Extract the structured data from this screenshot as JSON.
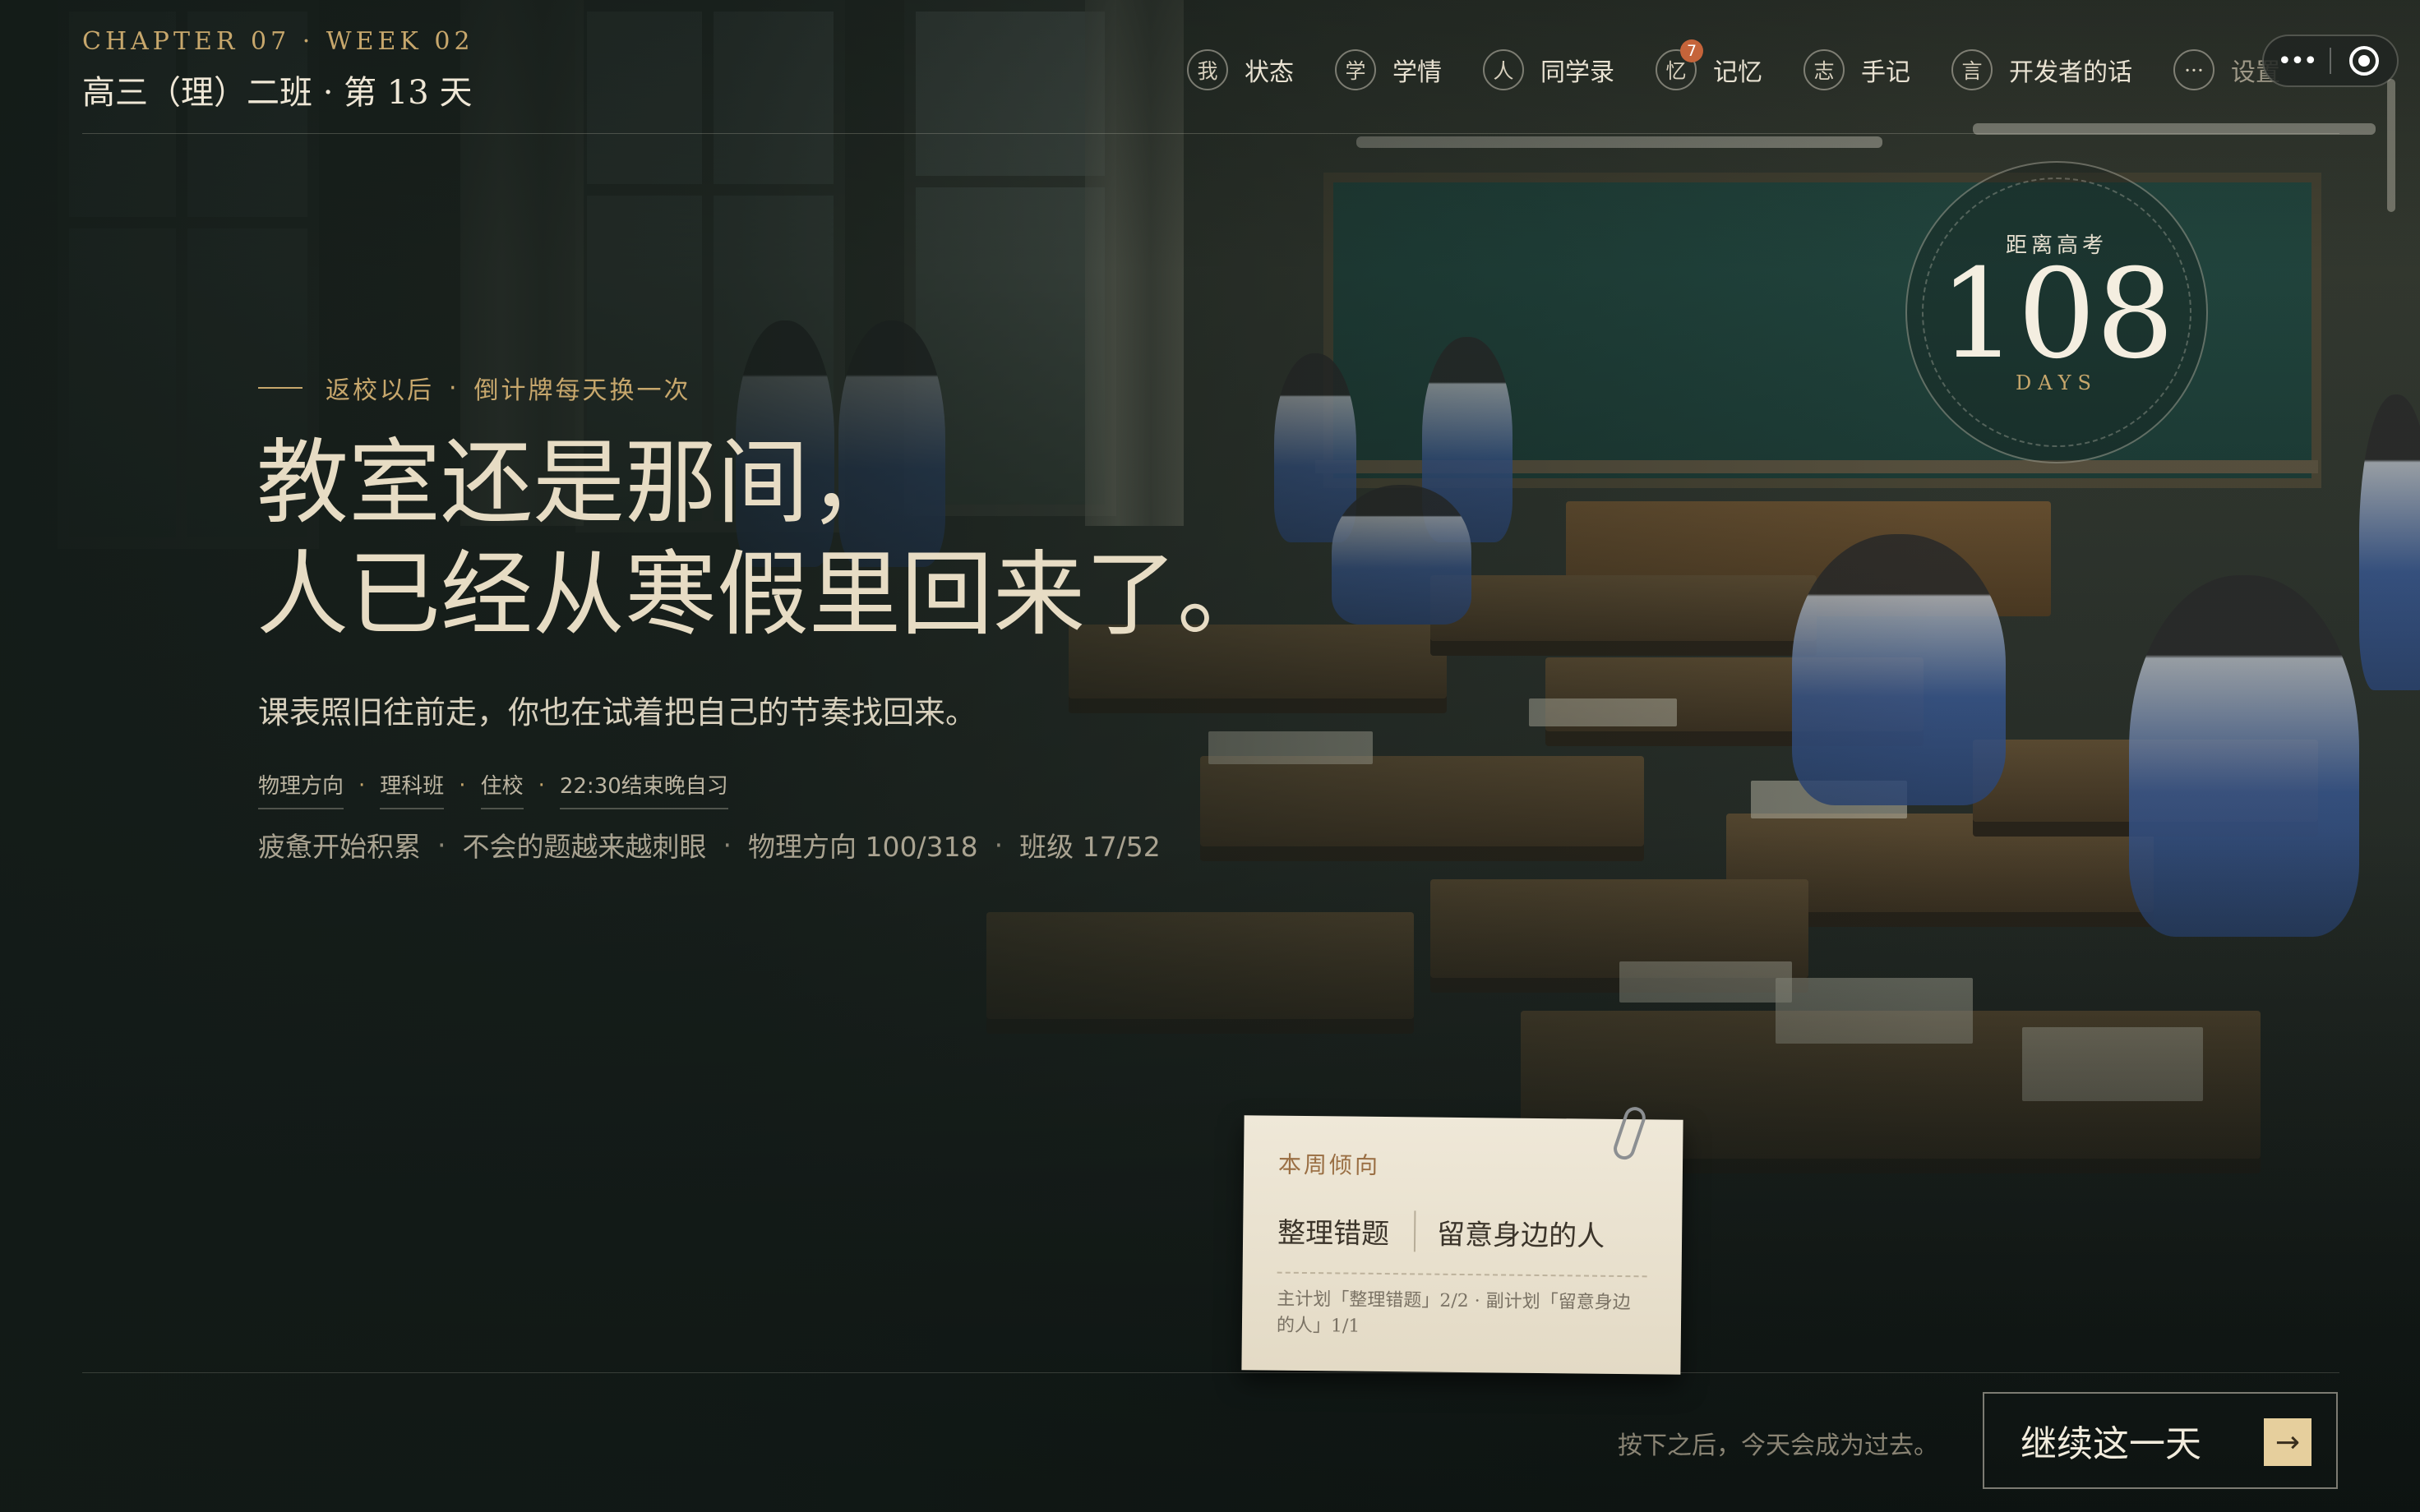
{
  "header": {
    "chapter": "CHAPTER 07 · WEEK 02",
    "class_title": "高三（理）二班 · 第 13 天"
  },
  "nav": {
    "items": [
      {
        "glyph": "我",
        "label": "状态"
      },
      {
        "glyph": "学",
        "label": "学情"
      },
      {
        "glyph": "人",
        "label": "同学录"
      },
      {
        "glyph": "忆",
        "label": "记忆",
        "badge": "7"
      },
      {
        "glyph": "志",
        "label": "手记"
      },
      {
        "glyph": "言",
        "label": "开发者的话"
      }
    ],
    "more": {
      "glyph": "···",
      "label": "设置"
    }
  },
  "window_controls": {
    "menu": "•••"
  },
  "countdown": {
    "label": "距离高考",
    "value": "108",
    "unit": "DAYS"
  },
  "hero": {
    "kicker_a": "返校以后",
    "kicker_dot": "·",
    "kicker_b": "倒计牌每天换一次",
    "headline_1": "教室还是那间，",
    "headline_2": "人已经从寒假里回来了。",
    "subline": "课表照旧往前走，你也在试着把自己的节奏找回来。",
    "tags": [
      "物理方向",
      "理科班",
      "住校",
      "22:30结束晚自习"
    ],
    "status": [
      "疲惫开始积累",
      "不会的题越来越刺眼",
      "物理方向 100/318",
      "班级 17/52"
    ]
  },
  "note": {
    "heading": "本周倾向",
    "primary": "整理错题",
    "secondary": "留意身边的人",
    "footer": "主计划「整理错题」2/2 · 副计划「留意身边的人」1/1"
  },
  "footer": {
    "hint": "按下之后，今天会成为过去。",
    "continue_label": "继续这一天",
    "continue_arrow": "→"
  }
}
